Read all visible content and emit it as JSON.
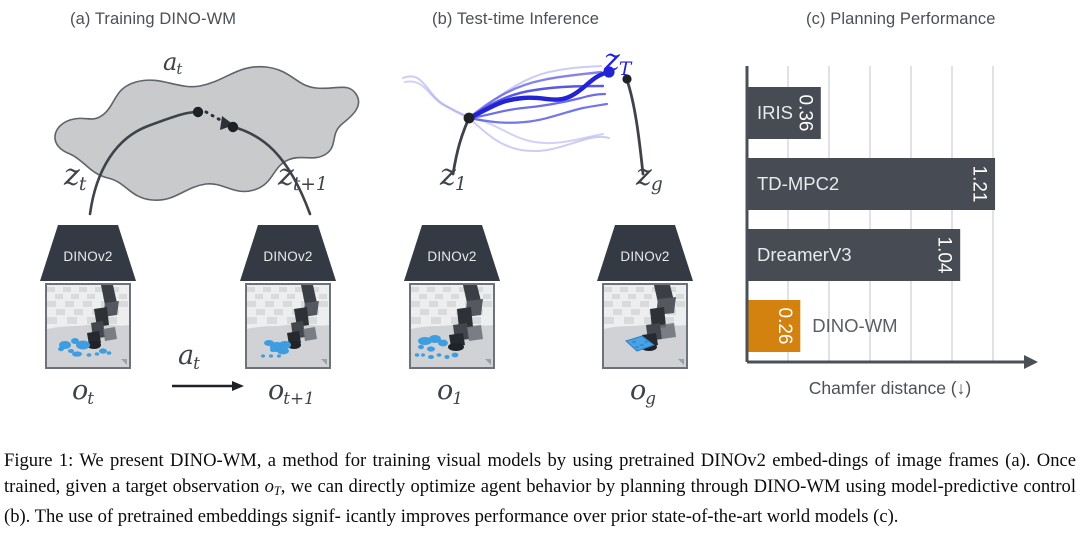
{
  "panels": {
    "a": {
      "title": "(a) Training DINO-WM"
    },
    "b": {
      "title": "(b) Test-time Inference"
    },
    "c": {
      "title": "(c) Planning Performance"
    }
  },
  "encoder": {
    "label": "DINOv2"
  },
  "panel_a": {
    "latent_start": "z",
    "latent_start_sub": "t",
    "latent_end": "z",
    "latent_end_sub": "t+1",
    "action_on_manifold": "a",
    "action_on_manifold_sub": "t",
    "action_between": "a",
    "action_between_sub": "t",
    "obs_start": "o",
    "obs_start_sub": "t",
    "obs_end": "o",
    "obs_end_sub": "t+1"
  },
  "panel_b": {
    "latent_start": "z",
    "latent_start_sub": "1",
    "latent_goal": "z",
    "latent_goal_sub": "g",
    "latent_pred": "z",
    "latent_pred_sub": "T",
    "obs_start": "o",
    "obs_start_sub": "1",
    "obs_goal": "o",
    "obs_goal_sub": "g"
  },
  "chart_data": {
    "type": "bar",
    "orientation": "horizontal",
    "title": "(c) Planning Performance",
    "xlabel": "Chamfer distance (↓)",
    "ylabel": "",
    "categories": [
      "IRIS",
      "TD-MPC2",
      "DreamerV3",
      "DINO-WM"
    ],
    "values": [
      0.36,
      1.21,
      1.04,
      0.26
    ],
    "value_labels": [
      "0.36",
      "1.21",
      "1.04",
      "0.26"
    ],
    "colors": [
      "#464b54",
      "#464b54",
      "#464b54",
      "#d4820f"
    ],
    "highlight_index": 3,
    "xlim": [
      0,
      1.4
    ],
    "gridlines": [
      0.2,
      0.4,
      0.6,
      0.8,
      1.0,
      1.2
    ],
    "grid": true,
    "legend": "none",
    "bar_label_position": [
      "inside",
      "inside",
      "inside",
      "outside"
    ],
    "value_label_rotation": 90
  },
  "palette": {
    "bar_dark": "#464b54",
    "bar_accent": "#d4820f",
    "grid": "#d9dadd",
    "axis": "#4b5057",
    "title_text": "#4b5057",
    "trajectory_blue": "#2323d6",
    "manifold_fill": "#c9cacb",
    "manifold_stroke": "#5f646b"
  },
  "caption": {
    "prefix": "Figure 1:",
    "line1": " We present DINO-WM, a method for training visual models by using pretrained DINOv2 embed-",
    "line2a": "dings of image frames (a). Once trained, given a target observation ",
    "line2_math": "o",
    "line2_math_sub": "T",
    "line2b": ", we can directly optimize agent behavior",
    "line3": "by planning through DINO-WM using model-predictive control (b). The use of pretrained embeddings signif-",
    "line4": "icantly improves performance over prior state-of-the-art world models (c)."
  }
}
